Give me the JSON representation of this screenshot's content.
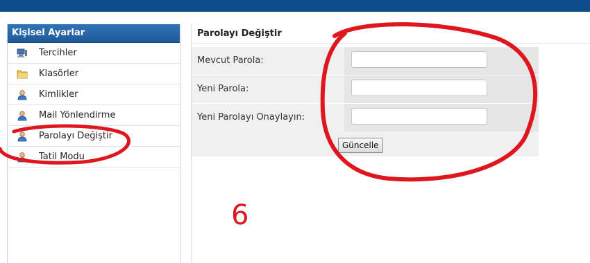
{
  "sidebar": {
    "title": "Kişisel Ayarlar",
    "items": [
      {
        "label": "Tercihler",
        "icon": "monitor-icon"
      },
      {
        "label": "Klasörler",
        "icon": "folder-icon"
      },
      {
        "label": "Kimlikler",
        "icon": "user-icon"
      },
      {
        "label": "Mail Yönlendirme",
        "icon": "user-icon"
      },
      {
        "label": "Parolayı Değiştir",
        "icon": "user-icon"
      },
      {
        "label": "Tatil Modu",
        "icon": "user-icon"
      }
    ]
  },
  "main": {
    "title": "Parolayı Değiştir",
    "fields": [
      {
        "label": "Mevcut Parola:",
        "value": ""
      },
      {
        "label": "Yeni Parola:",
        "value": ""
      },
      {
        "label": "Yeni Parolayı Onaylayın:",
        "value": ""
      }
    ],
    "submit_label": "Güncelle"
  },
  "annotation": {
    "number": "6",
    "color": "#e0161e"
  },
  "colors": {
    "topbar": "#0c4e8b",
    "sidebar_header": "#1f5a97",
    "form_background": "#f0f0f0"
  }
}
